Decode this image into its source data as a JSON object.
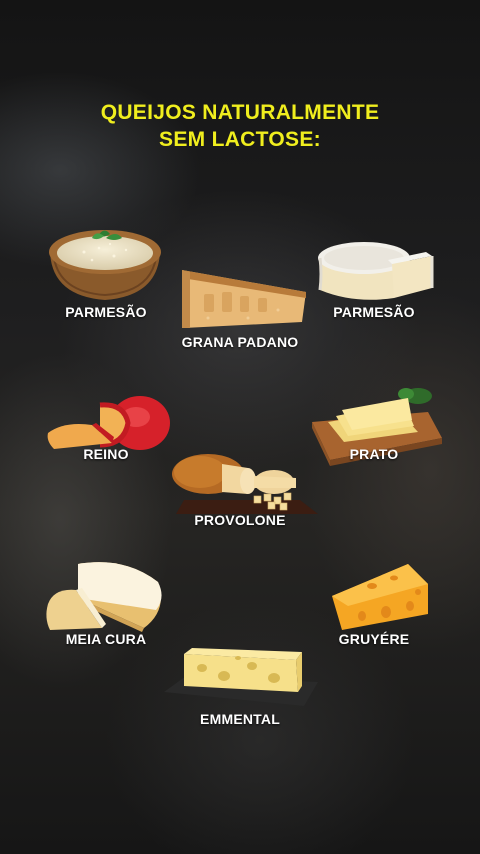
{
  "title": {
    "line1": "QUEIJOS NATURALMENTE",
    "line2": "SEM LACTOSE:"
  },
  "colors": {
    "title": "#f0ee1e",
    "label": "#ffffff"
  },
  "cheeses": [
    {
      "label": "PARMESÃO",
      "icon": "grated-parmesan-bowl-icon"
    },
    {
      "label": "GRANA PADANO",
      "icon": "grana-padano-wedge-icon"
    },
    {
      "label": "PARMESÃO",
      "icon": "parmesan-round-icon"
    },
    {
      "label": "REINO",
      "icon": "reino-cheese-icon"
    },
    {
      "label": "PRATO",
      "icon": "prato-slices-icon"
    },
    {
      "label": "PROVOLONE",
      "icon": "provolone-icon"
    },
    {
      "label": "MEIA CURA",
      "icon": "meia-cura-icon"
    },
    {
      "label": "GRUYÉRE",
      "icon": "gruyere-wedge-icon"
    },
    {
      "label": "EMMENTAL",
      "icon": "emmental-block-icon"
    }
  ]
}
